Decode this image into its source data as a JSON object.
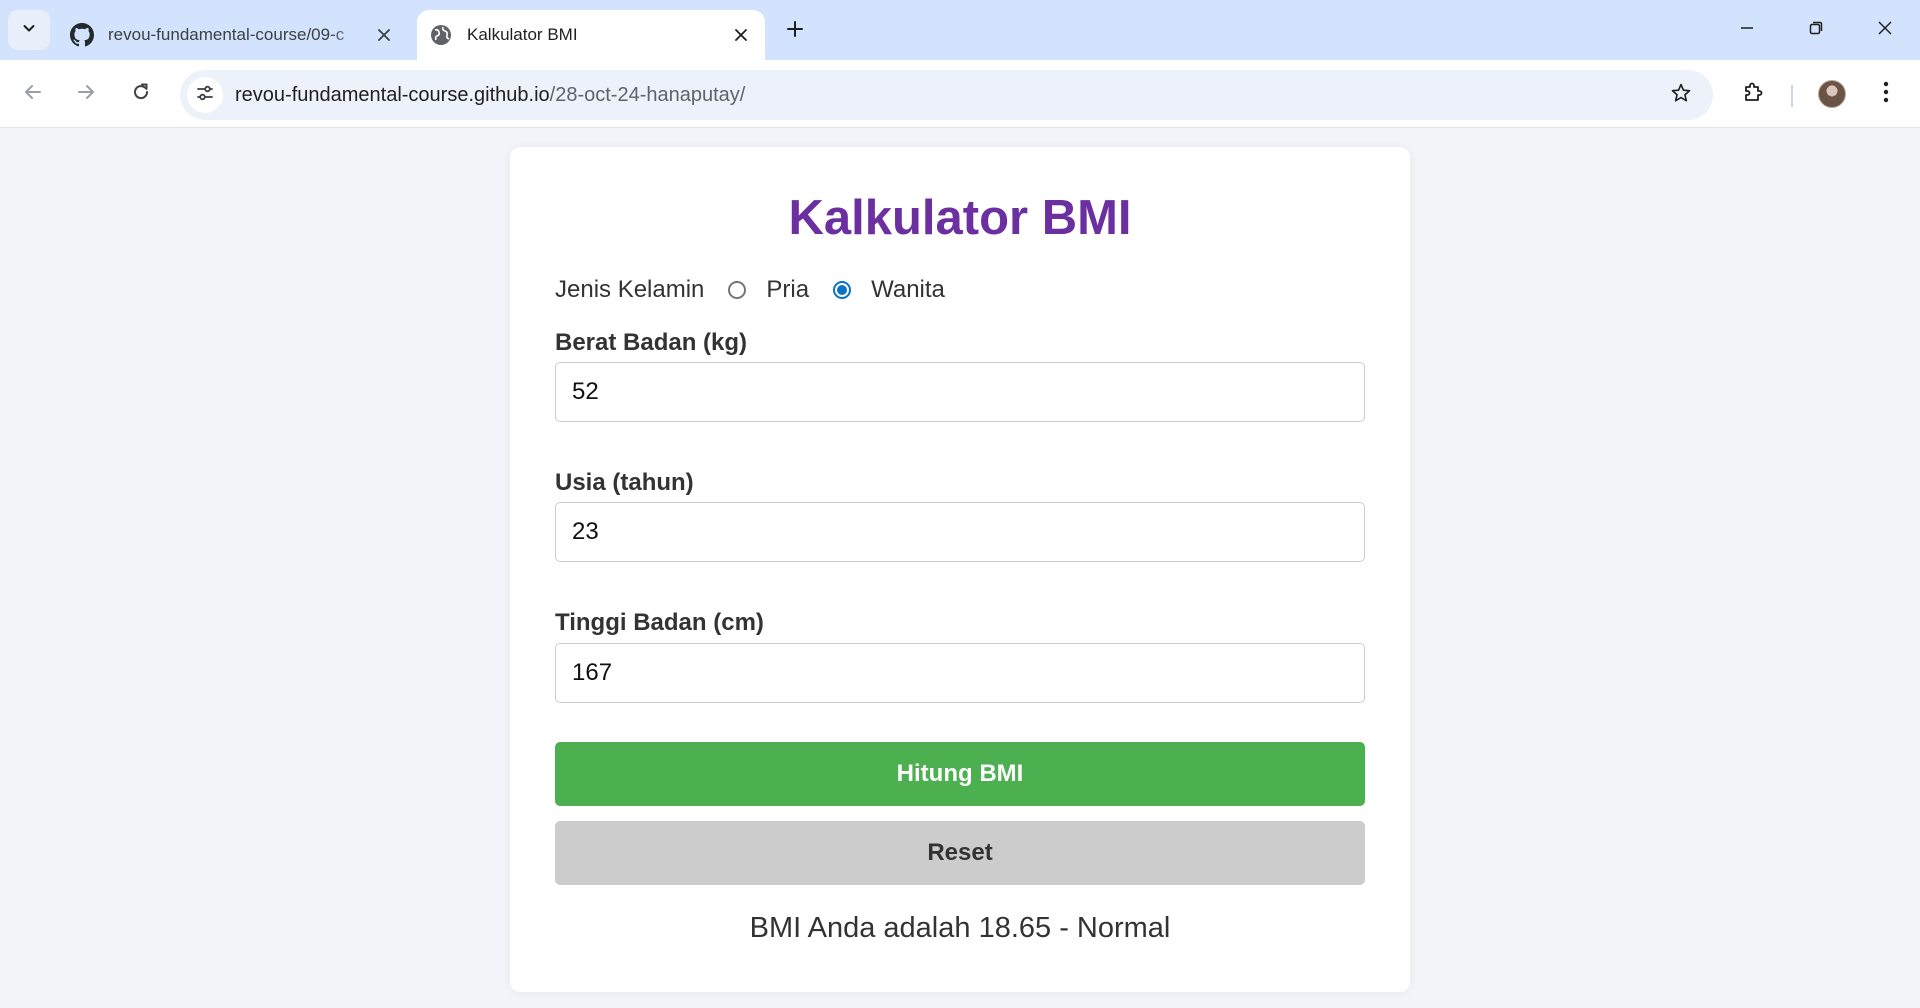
{
  "browser": {
    "tabs": [
      {
        "title": "revou-fundamental-course/09-c",
        "favicon": "github-icon",
        "active": false
      },
      {
        "title": "Kalkulator BMI",
        "favicon": "globe-icon",
        "active": true
      }
    ],
    "url_host": "revou-fundamental-course.github.io",
    "url_path": "/28-oct-24-hanaputay/"
  },
  "page": {
    "title": "Kalkulator BMI",
    "gender": {
      "label": "Jenis Kelamin",
      "options": [
        {
          "label": "Pria",
          "checked": false
        },
        {
          "label": "Wanita",
          "checked": true
        }
      ]
    },
    "weight": {
      "label": "Berat Badan (kg)",
      "value": "52"
    },
    "age": {
      "label": "Usia (tahun)",
      "value": "23"
    },
    "height": {
      "label": "Tinggi Badan (cm)",
      "value": "167"
    },
    "calculate_label": "Hitung BMI",
    "reset_label": "Reset",
    "result": "BMI Anda adalah 18.65 - Normal"
  },
  "colors": {
    "title": "#6b2fa0",
    "calculate_button": "#4caf50",
    "reset_button": "#cccccc",
    "radio_accent": "#0b72c6"
  }
}
